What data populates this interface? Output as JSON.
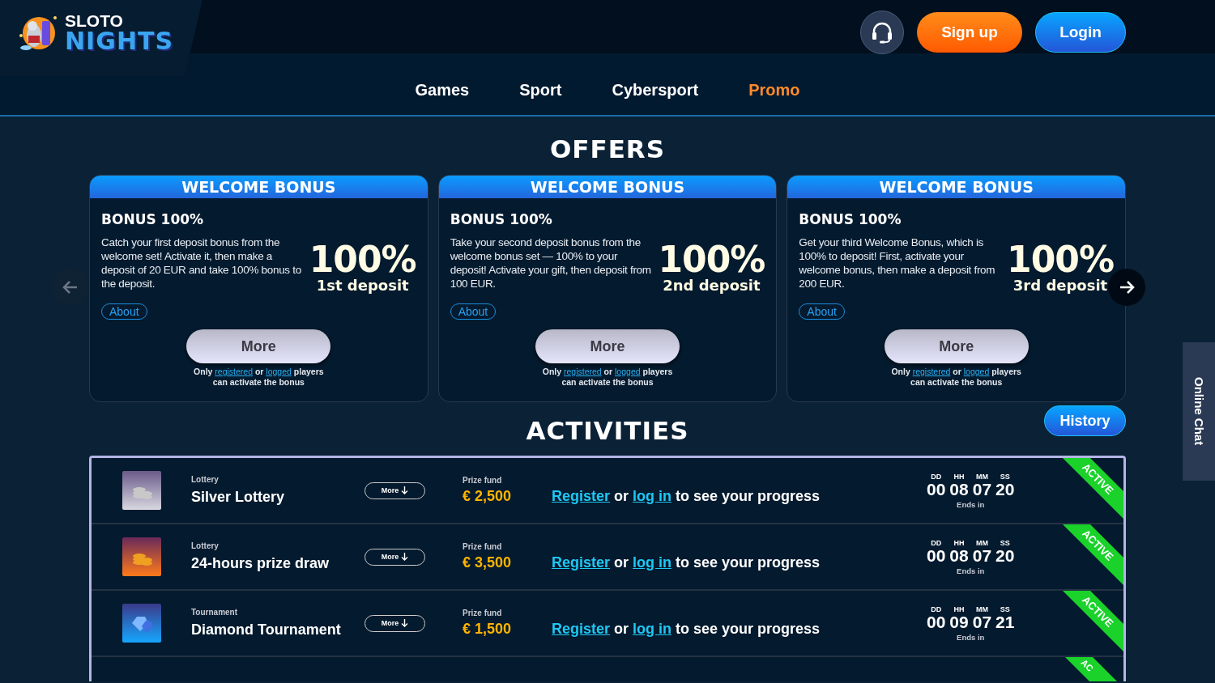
{
  "header": {
    "logo": {
      "line1": "SLOTO",
      "line2": "NIGHTS"
    },
    "signup": "Sign up",
    "login": "Login"
  },
  "nav": [
    {
      "label": "Games",
      "selected": false
    },
    {
      "label": "Sport",
      "selected": false
    },
    {
      "label": "Cybersport",
      "selected": false
    },
    {
      "label": "Promo",
      "selected": true
    }
  ],
  "offers": {
    "title": "OFFERS",
    "arrows": [
      {
        "kind": "prev",
        "disabled": true
      },
      {
        "kind": "next",
        "disabled": false
      }
    ],
    "cards": [
      {
        "header": "WELCOME BONUS",
        "title": "BONUS 100%",
        "description": "Catch your first deposit bonus from the welcome set! Activate it, then make a deposit of 20 EUR and take 100% bonus to the deposit.",
        "big_value": "100%",
        "deposit": "1st deposit",
        "about": "About",
        "more": "More",
        "note": {
          "before": "Only",
          "link1": "registered",
          "middle": "or",
          "link2": "logged",
          "after": "players can activate the bonus"
        }
      },
      {
        "header": "WELCOME BONUS",
        "title": "BONUS 100%",
        "description": "Take your second deposit bonus from the welcome bonus set — 100% to your deposit! Activate your gift, then deposit from 100 EUR.",
        "big_value": "100%",
        "deposit": "2nd deposit",
        "about": "About",
        "more": "More",
        "note": {
          "before": "Only",
          "link1": "registered",
          "middle": "or",
          "link2": "logged",
          "after": "players can activate the bonus"
        }
      },
      {
        "header": "WELCOME BONUS",
        "title": "BONUS 100%",
        "description": "Get your third Welcome Bonus, which is 100% to deposit! First, activate your welcome bonus, then make a deposit from 200 EUR.",
        "big_value": "100%",
        "deposit": "3rd deposit",
        "about": "About",
        "more": "More",
        "note": {
          "before": "Only",
          "link1": "registered",
          "middle": "or",
          "link2": "logged",
          "after": "players can activate the bonus"
        }
      }
    ]
  },
  "activities": {
    "title": "ACTIVITIES",
    "history": "History",
    "rows": [
      {
        "category": "Lottery",
        "name": "Silver Lottery",
        "more": "More",
        "prize_label": "Prize fund",
        "prize": "€ 2,500",
        "progress": {
          "link1": "Register",
          "middle": "or",
          "link2": "log in",
          "after": "to see your progress"
        },
        "timer": {
          "labels": [
            "DD",
            "HH",
            "MM",
            "SS"
          ],
          "values": [
            "00",
            "08",
            "07",
            "20"
          ],
          "caption": "Ends in"
        },
        "status": "ACTIVE"
      },
      {
        "category": "Lottery",
        "name": "24-hours prize draw",
        "more": "More",
        "prize_label": "Prize fund",
        "prize": "€ 3,500",
        "progress": {
          "link1": "Register",
          "middle": "or",
          "link2": "log in",
          "after": "to see your progress"
        },
        "timer": {
          "labels": [
            "DD",
            "HH",
            "MM",
            "SS"
          ],
          "values": [
            "00",
            "08",
            "07",
            "20"
          ],
          "caption": "Ends in"
        },
        "status": "ACTIVE"
      },
      {
        "category": "Tournament",
        "name": "Diamond Tournament",
        "more": "More",
        "prize_label": "Prize fund",
        "prize": "€ 1,500",
        "progress": {
          "link1": "Register",
          "middle": "or",
          "link2": "log in",
          "after": "to see your progress"
        },
        "timer": {
          "labels": [
            "DD",
            "HH",
            "MM",
            "SS"
          ],
          "values": [
            "00",
            "09",
            "07",
            "21"
          ],
          "caption": "Ends in"
        },
        "status": "ACTIVE"
      }
    ],
    "partial_row_status": "AC"
  },
  "online_chat": "Online Chat"
}
